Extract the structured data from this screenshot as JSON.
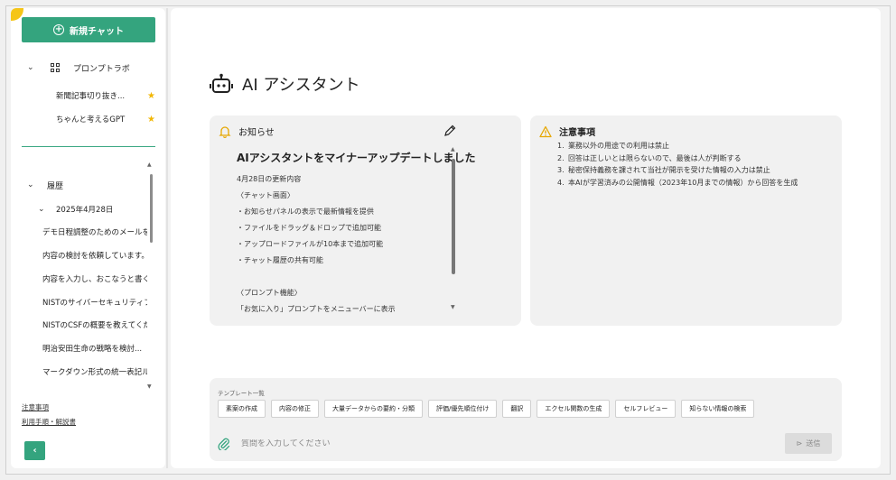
{
  "sidebar": {
    "new_chat_label": "新規チャット",
    "prompt_lab_label": "プロンプトラボ",
    "favorites": [
      {
        "label": "新聞記事切り抜き..."
      },
      {
        "label": "ちゃんと考えるGPT"
      }
    ],
    "history_label": "履歴",
    "date_group": "2025年4月28日",
    "history_items": [
      "デモ日程調整のためのメールを...",
      "内容の検討を依頼しています。",
      "内容を入力し、おこなうと書くこ...",
      "NISTのサイバーセキュリティフレー...",
      "NISTのCSFの概要を教えてくだ...",
      "明治安田生命の戦略を検討...",
      "マークダウン形式の統一表記ル..."
    ],
    "footer_links": [
      "注意事項",
      "利用手順・解説書"
    ],
    "collapse_label": "‹"
  },
  "main": {
    "title": "AI アシスタント"
  },
  "notice": {
    "header": "お知らせ",
    "title": "AIアシスタントをマイナーアップデートしました",
    "lines": [
      "4月28日の更新内容",
      "〈チャット画面〉",
      "・お知らせパネルの表示で最新情報を提供",
      "・ファイルをドラッグ＆ドロップで追加可能",
      "・アップロードファイルが10本まで追加可能",
      "・チャット履歴の共有可能",
      "",
      "〈プロンプト機能〉",
      "「お気に入り」プロンプトをメニューバーに表示"
    ]
  },
  "caution": {
    "header": "注意事項",
    "items": [
      "業務以外の用途での利用は禁止",
      "回答は正しいとは限らないので、最後は人が判断する",
      "秘密保持義務を課されて当社が開示を受けた情報の入力は禁止",
      "本AIが学習済みの公開情報（2023年10月までの情報）から回答を生成"
    ]
  },
  "templates": {
    "label": "テンプレート一覧",
    "chips": [
      "素案の作成",
      "内容の修正",
      "大量データからの要約・分類",
      "評価/優先順位付け",
      "翻訳",
      "エクセル関数の生成",
      "セルフレビュー",
      "知らない情報の検索"
    ]
  },
  "composer": {
    "placeholder": "質問を入力してください",
    "send_label": "送信"
  },
  "colors": {
    "accent": "#34a47e",
    "star": "#f2b705",
    "bell": "#e6a700"
  },
  "icons": [
    "plus-circle-icon",
    "grid-icon",
    "star-icon",
    "chevron-down-icon",
    "robot-icon",
    "bell-icon",
    "pencil-icon",
    "warning-icon",
    "paperclip-icon",
    "send-icon"
  ]
}
